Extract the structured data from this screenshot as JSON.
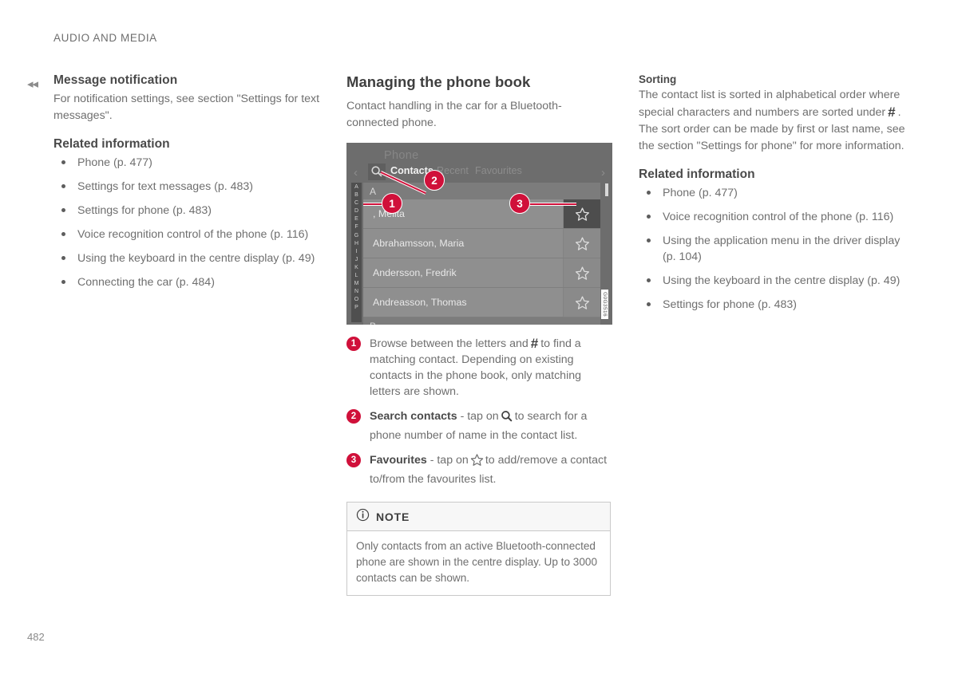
{
  "header": {
    "running_title": "AUDIO AND MEDIA",
    "page_number": "482"
  },
  "left_column": {
    "continuation_marker": "◂◂",
    "section_title": "Message notification",
    "intro": "For notification settings, see section \"Settings for text messages\".",
    "related_title": "Related information",
    "related_items": [
      {
        "label": "Phone (p. 477)"
      },
      {
        "label": "Settings for text messages (p. 483)"
      },
      {
        "label": "Settings for phone (p. 483)"
      },
      {
        "label": "Voice recognition control of the phone (p. 116)"
      },
      {
        "label": "Using the keyboard in the centre display (p. 49)"
      },
      {
        "label": "Connecting the car (p. 484)"
      }
    ]
  },
  "middle_column": {
    "article_title": "Managing the phone book",
    "intro": "Contact handling in the car for a Bluetooth-connected phone.",
    "screenshot": {
      "app_title": "Phone",
      "image_code": "G0G3516",
      "tabs": [
        {
          "label": "Contacts",
          "active": true
        },
        {
          "label": "Recent",
          "active": false
        },
        {
          "label": "Favourites",
          "active": false
        }
      ],
      "nav_left": "‹",
      "nav_right": "›",
      "search_icon": "search-icon",
      "alphabet": [
        "A",
        "B",
        "C",
        "D",
        "E",
        "F",
        "G",
        "H",
        "I",
        "J",
        "K",
        "L",
        "M",
        "N",
        "O",
        "P"
      ],
      "groups": [
        {
          "letter": "A",
          "contacts": [
            {
              "name": ", Melita",
              "favourite_selected": true
            },
            {
              "name": "Abrahamsson, Maria",
              "favourite_selected": false
            },
            {
              "name": "Andersson, Fredrik",
              "favourite_selected": false
            },
            {
              "name": "Andreasson, Thomas",
              "favourite_selected": false
            }
          ]
        },
        {
          "letter": "B",
          "contacts": []
        }
      ],
      "markers": [
        "1",
        "2",
        "3"
      ]
    },
    "callouts": [
      {
        "number": "1",
        "bold_lead": "",
        "text_before_icon": "Browse between the letters and",
        "icon": "hash-glyph",
        "text_after_icon": "to find a matching contact. Depending on existing contacts in the phone book, only matching letters are shown."
      },
      {
        "number": "2",
        "bold_lead": "Search contacts",
        "text_before_icon": "- tap on",
        "icon": "search-icon",
        "text_after_icon": "to search for a phone number of name in the contact list."
      },
      {
        "number": "3",
        "bold_lead": "Favourites",
        "text_before_icon": "- tap on",
        "icon": "star-icon",
        "text_after_icon": "to add/remove a contact to/from the favourites list."
      }
    ],
    "note": {
      "icon": "info-icon",
      "title": "NOTE",
      "body": "Only contacts from an active Bluetooth-connected phone are shown in the centre display. Up to 3000 contacts can be shown."
    }
  },
  "right_column": {
    "sorting_title": "Sorting",
    "sorting_text_1": "The contact list is sorted in alphabetical order where special characters and numbers are sorted under",
    "sorting_hash": "#",
    "sorting_text_2": ". The sort order can be made by first or last name, see the section \"Settings for phone\" for more information.",
    "related_title": "Related information",
    "related_items": [
      {
        "label": "Phone (p. 477)"
      },
      {
        "label": "Voice recognition control of the phone (p. 116)"
      },
      {
        "label": "Using the application menu in the driver display (p. 104)"
      },
      {
        "label": "Using the keyboard in the centre display (p. 49)"
      },
      {
        "label": "Settings for phone (p. 483)"
      }
    ]
  },
  "colors": {
    "accent_red": "#d0103a",
    "text_gray": "#6f6f6f",
    "heading_gray": "#4a4a4a",
    "screenshot_bg": "#6d6d6d",
    "row_bg": "#8f8f8f"
  }
}
